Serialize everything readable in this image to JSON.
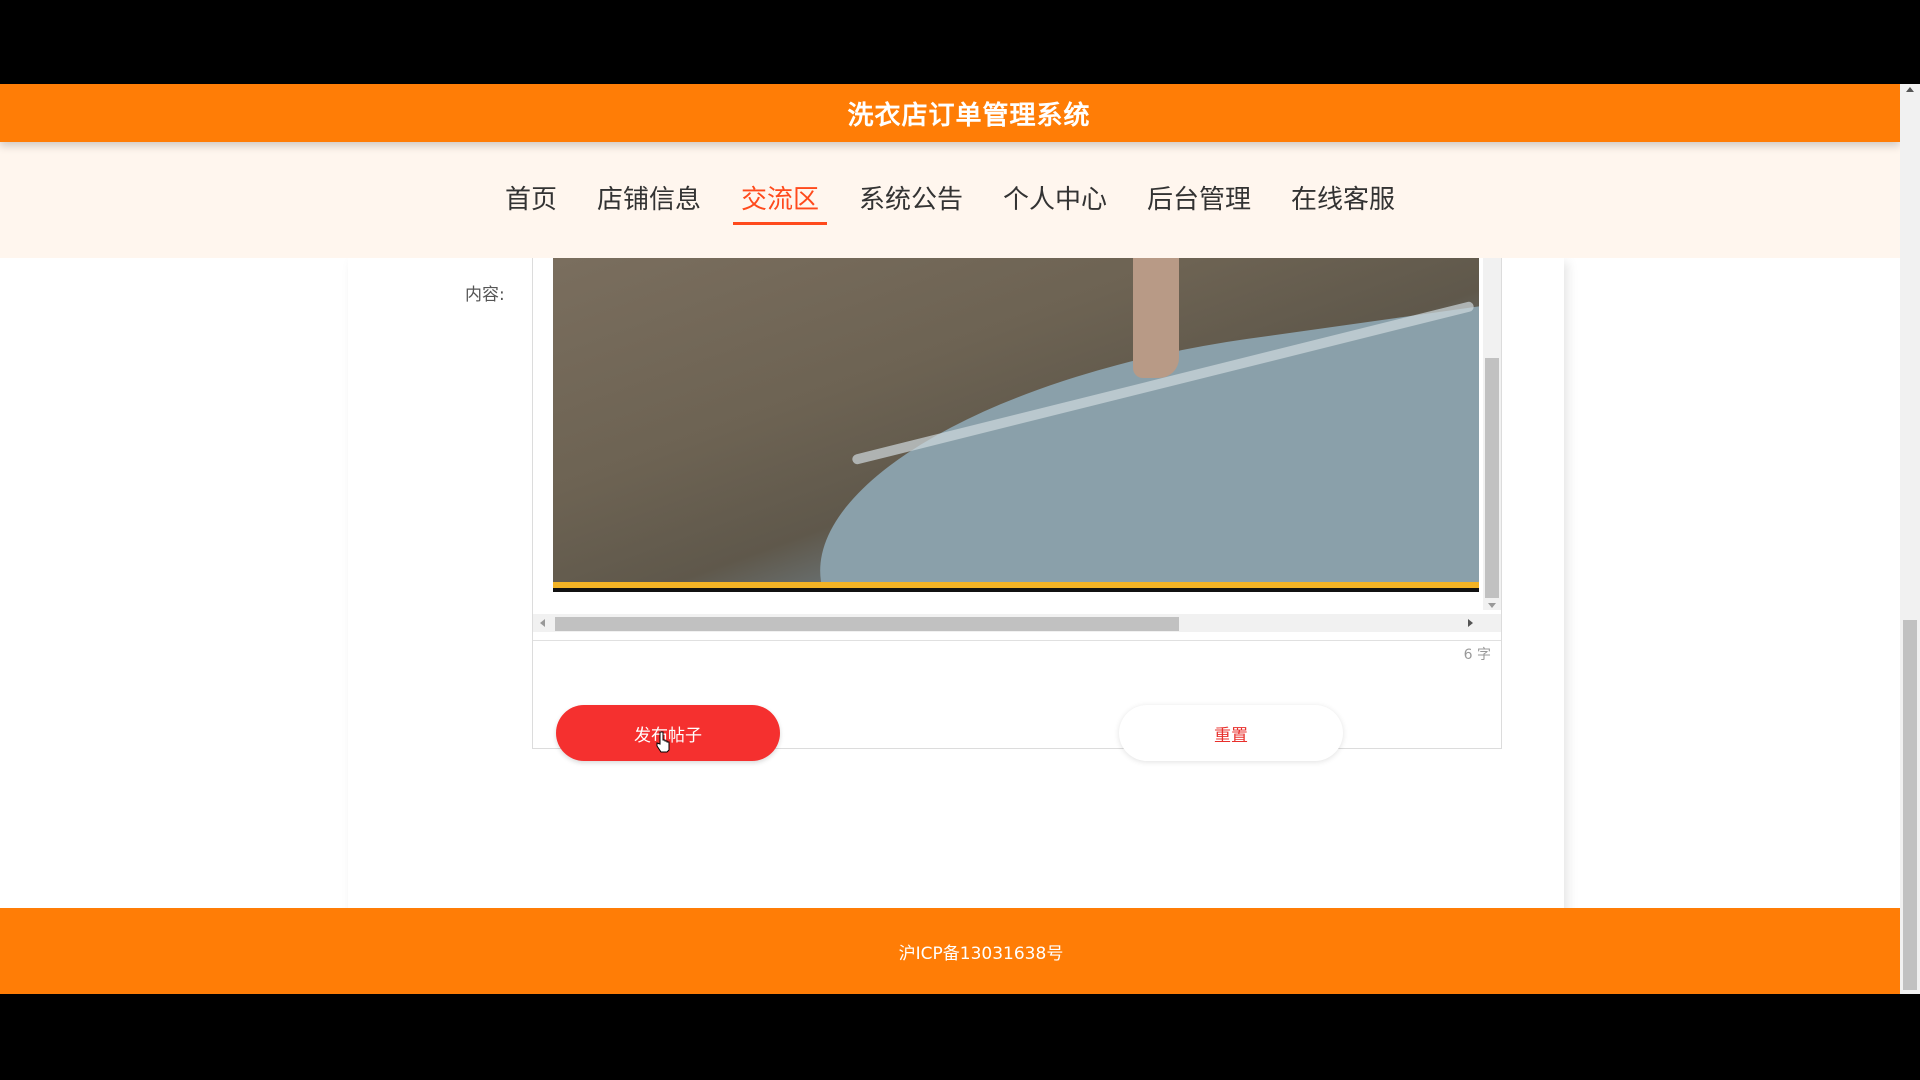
{
  "header": {
    "title": "洗衣店订单管理系统"
  },
  "nav": {
    "items": [
      {
        "label": "首页"
      },
      {
        "label": "店铺信息"
      },
      {
        "label": "交流区"
      },
      {
        "label": "系统公告"
      },
      {
        "label": "个人中心"
      },
      {
        "label": "后台管理"
      },
      {
        "label": "在线客服"
      }
    ],
    "active": "交流区"
  },
  "form": {
    "content_label": "内容:",
    "word_count": "6 字",
    "publish_label": "发布帖子",
    "reset_label": "重置"
  },
  "footer": {
    "icp": "沪ICP备13031638号"
  },
  "colors": {
    "brand_orange": "#ff7d06",
    "nav_bg": "#fff6ee",
    "active_nav": "#ff4a1c",
    "publish_red": "#f5302f",
    "reset_text": "#e8302c"
  }
}
